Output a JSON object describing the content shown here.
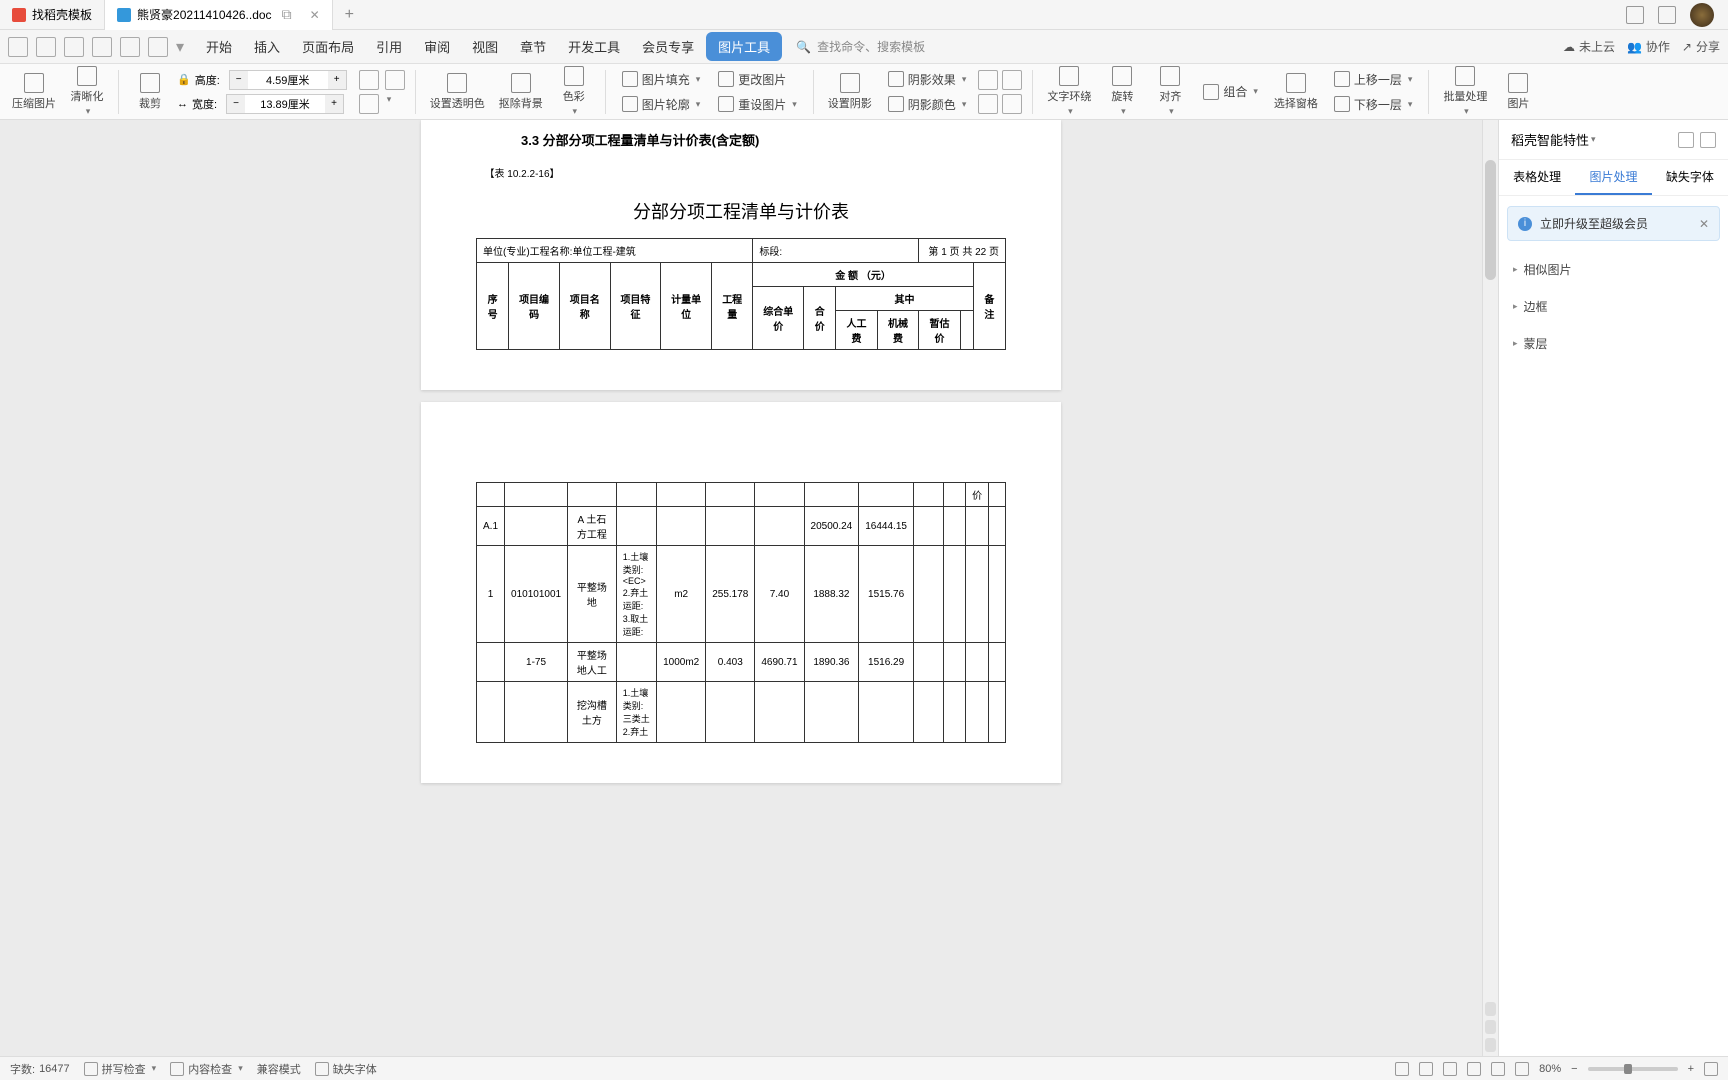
{
  "tabs": [
    {
      "icon": "red",
      "label": "找稻壳模板"
    },
    {
      "icon": "blue",
      "label": "熊贤豪20211410426..doc"
    }
  ],
  "titlebar_ctrl": "⧉",
  "menus": {
    "items": [
      "开始",
      "插入",
      "页面布局",
      "引用",
      "审阅",
      "视图",
      "章节",
      "开发工具",
      "会员专享"
    ],
    "active": "图片工具",
    "search_ph": "查找命令、搜索模板"
  },
  "menubar_right": {
    "cloud": "未上云",
    "collab": "协作",
    "share": "分享"
  },
  "ribbon": {
    "compress": "压缩图片",
    "clarity": "清晰化",
    "crop": "裁剪",
    "height_lbl": "高度:",
    "height_val": "4.59厘米",
    "width_lbl": "宽度:",
    "width_val": "13.89厘米",
    "transp": "设置透明色",
    "removebg": "抠除背景",
    "color": "色彩",
    "fill": "图片填充",
    "change": "更改图片",
    "outline": "图片轮廓",
    "reset": "重设图片",
    "shadoweff": "阴影效果",
    "setshadow": "设置阴影",
    "shadowcolor": "阴影颜色",
    "wrap": "文字环绕",
    "rotate": "旋转",
    "align": "对齐",
    "combine": "组合",
    "selwin": "选择窗格",
    "moveup": "上移一层",
    "movedn": "下移一层",
    "batch": "批量处理",
    "pic": "图片"
  },
  "doc": {
    "heading": "3.3 分部分项工程量清单与计价表(含定额)",
    "table_no": "【表 10.2.2-16】",
    "title": "分部分项工程清单与计价表",
    "unit_label": "单位(专业)工程名称:单位工程-建筑",
    "section_label": "标段:",
    "page_label": "第 1 页  共 22 页",
    "headers": {
      "seq": "序号",
      "code": "项目编码",
      "name": "项目名称",
      "feature": "项目特征",
      "unit": "计量单位",
      "qty": "工程量",
      "amount": "金 额  （元）",
      "unitprice": "综合单价",
      "total": "合价",
      "sub": "其中",
      "labor": "人工费",
      "machine": "机械费",
      "temp": "暂估价",
      "remark": "备注"
    },
    "rows": [
      {
        "seq": "A.1",
        "code": "",
        "name": "A 土石方工程",
        "feature": "",
        "unit": "",
        "qty": "",
        "unitprice": "",
        "total": "20500.24",
        "labor": "16444.15",
        "machine": "",
        "temp": "",
        "remark": ""
      },
      {
        "seq": "1",
        "code": "010101001",
        "name": "平整场地",
        "feature": "1.土壤类别:<EC>\n2.弃土运距:\n3.取土运距:",
        "unit": "m2",
        "qty": "255.178",
        "unitprice": "7.40",
        "total": "1888.32",
        "labor": "1515.76",
        "machine": "",
        "temp": "",
        "remark": ""
      },
      {
        "seq": "",
        "code": "1-75",
        "name": "平整场地人工",
        "feature": "",
        "unit": "1000m2",
        "qty": "0.403",
        "unitprice": "4690.71",
        "total": "1890.36",
        "labor": "1516.29",
        "machine": "",
        "temp": "",
        "remark": ""
      },
      {
        "seq": "",
        "code": "",
        "name": "挖沟槽土方",
        "feature": "1.土壤类别:三类土\n2.弃土",
        "unit": "",
        "qty": "",
        "unitprice": "",
        "total": "",
        "labor": "",
        "machine": "",
        "temp": "",
        "remark": ""
      }
    ],
    "price_col": "价"
  },
  "sidepanel": {
    "title": "稻壳智能特性",
    "tabs": [
      "表格处理",
      "图片处理",
      "缺失字体"
    ],
    "active_tab": "图片处理",
    "banner": "立即升级至超级会员",
    "sections": [
      "相似图片",
      "边框",
      "蒙层"
    ]
  },
  "statusbar": {
    "wordcount_lbl": "字数:",
    "wordcount": "16477",
    "spellcheck": "拼写检查",
    "contentcheck": "内容检查",
    "compat": "兼容模式",
    "missfont": "缺失字体",
    "zoom": "80%"
  }
}
